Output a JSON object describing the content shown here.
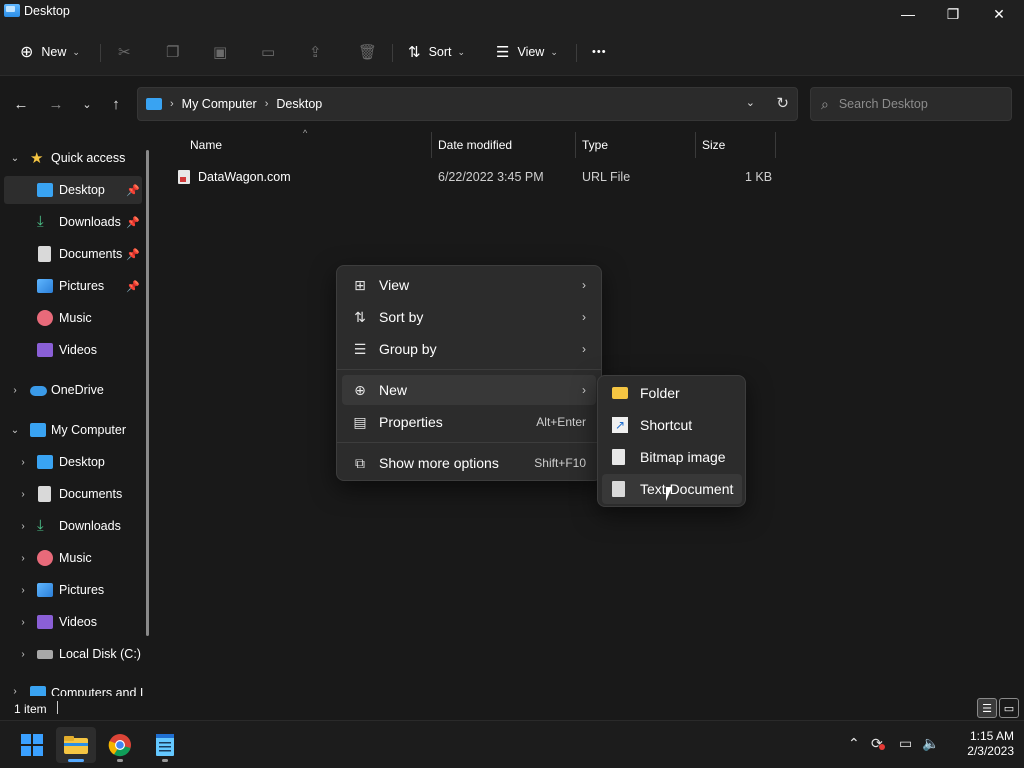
{
  "window": {
    "title": "Desktop",
    "minimize": "—",
    "maximize": "❐",
    "close": "✕"
  },
  "toolbar": {
    "new_label": "New",
    "sort_label": "Sort",
    "view_label": "View",
    "more_label": "•••",
    "chevron": "⌄"
  },
  "address": {
    "crumbs": [
      "My Computer",
      "Desktop"
    ],
    "separator": "›",
    "search_placeholder": "Search Desktop"
  },
  "sidebar": {
    "quick_access": "Quick access",
    "quick_items": [
      {
        "label": "Desktop",
        "icon": "desktop-icon",
        "pinned": true
      },
      {
        "label": "Downloads",
        "icon": "download-icon",
        "pinned": true
      },
      {
        "label": "Documents",
        "icon": "document-icon",
        "pinned": true
      },
      {
        "label": "Pictures",
        "icon": "pictures-icon",
        "pinned": true
      },
      {
        "label": "Music",
        "icon": "music-icon",
        "pinned": false
      },
      {
        "label": "Videos",
        "icon": "video-icon",
        "pinned": false
      }
    ],
    "onedrive": "OneDrive",
    "my_computer": "My Computer",
    "computer_items": [
      {
        "label": "Desktop"
      },
      {
        "label": "Documents"
      },
      {
        "label": "Downloads"
      },
      {
        "label": "Music"
      },
      {
        "label": "Pictures"
      },
      {
        "label": "Videos"
      },
      {
        "label": "Local Disk (C:)"
      }
    ],
    "network": "Computers and I"
  },
  "file_list": {
    "columns": {
      "name": "Name",
      "date": "Date modified",
      "type": "Type",
      "size": "Size"
    },
    "files": [
      {
        "name": "DataWagon.com",
        "date": "6/22/2022 3:45 PM",
        "type": "URL File",
        "size": "1 KB"
      }
    ]
  },
  "context_menu": {
    "view": "View",
    "sort_by": "Sort by",
    "group_by": "Group by",
    "new": "New",
    "properties": "Properties",
    "properties_shortcut": "Alt+Enter",
    "show_more": "Show more options",
    "show_more_shortcut": "Shift+F10"
  },
  "new_submenu": {
    "items": [
      "Folder",
      "Shortcut",
      "Bitmap image",
      "Text Document"
    ]
  },
  "status": {
    "item_count": "1 item"
  },
  "taskbar": {
    "time": "1:15 AM",
    "date": "2/3/2023"
  },
  "colors": {
    "background": "#191919",
    "menu": "#2c2c2c",
    "accent": "#55aaff",
    "folder": "#f5c542"
  }
}
